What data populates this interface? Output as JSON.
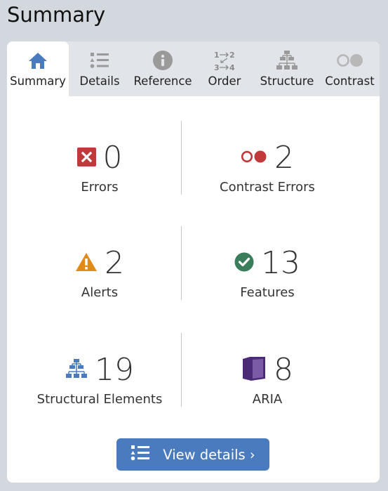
{
  "header": {
    "title": "Summary"
  },
  "tabs": [
    {
      "label": "Summary",
      "icon": "home-icon",
      "active": true
    },
    {
      "label": "Details",
      "icon": "list-icon",
      "active": false
    },
    {
      "label": "Reference",
      "icon": "info-icon",
      "active": false
    },
    {
      "label": "Order",
      "icon": "order-icon",
      "active": false
    },
    {
      "label": "Structure",
      "icon": "structure-icon",
      "active": false
    },
    {
      "label": "Contrast",
      "icon": "contrast-icon",
      "active": false
    }
  ],
  "stats": {
    "errors": {
      "value": "0",
      "label": "Errors",
      "color": "#c0393b"
    },
    "contrast_errors": {
      "value": "2",
      "label": "Contrast Errors",
      "color": "#c0393b"
    },
    "alerts": {
      "value": "2",
      "label": "Alerts",
      "color": "#e08a1a"
    },
    "features": {
      "value": "13",
      "label": "Features",
      "color": "#3a7d5a"
    },
    "structural": {
      "value": "19",
      "label": "Structural Elements",
      "color": "#4a7bbf"
    },
    "aria": {
      "value": "8",
      "label": "ARIA",
      "color": "#4b2a7a"
    }
  },
  "actions": {
    "view_details_label": "View details ›"
  },
  "colors": {
    "accent": "#4a7bbf",
    "tab_active_icon": "#4a7bbf",
    "tab_inactive_icon": "#9a9a9a"
  }
}
